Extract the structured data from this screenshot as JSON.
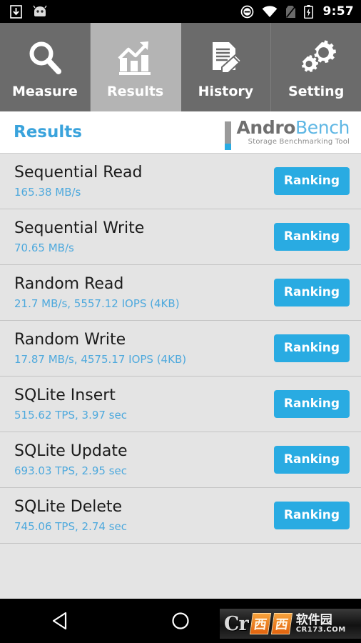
{
  "statusbar": {
    "time": "9:57",
    "left_icons": [
      "download-icon",
      "android-head-icon"
    ],
    "right_icons": [
      "do-not-disturb-icon",
      "wifi-icon",
      "no-sim-icon",
      "battery-charging-icon"
    ]
  },
  "tabs": [
    {
      "label": "Measure",
      "icon": "magnifier-icon",
      "active": false
    },
    {
      "label": "Results",
      "icon": "bar-chart-trend-icon",
      "active": true
    },
    {
      "label": "History",
      "icon": "document-pencil-icon",
      "active": false
    },
    {
      "label": "Setting",
      "icon": "gears-icon",
      "active": false
    }
  ],
  "header": {
    "title": "Results",
    "logo_primary": "Andro",
    "logo_secondary": "Bench",
    "logo_subtitle": "Storage Benchmarking Tool"
  },
  "results": {
    "button_label": "Ranking",
    "rows": [
      {
        "title": "Sequential Read",
        "value": "165.38 MB/s"
      },
      {
        "title": "Sequential Write",
        "value": "70.65 MB/s"
      },
      {
        "title": "Random Read",
        "value": "21.7 MB/s, 5557.12 IOPS (4KB)"
      },
      {
        "title": "Random Write",
        "value": "17.87 MB/s, 4575.17 IOPS (4KB)"
      },
      {
        "title": "SQLite Insert",
        "value": "515.62 TPS, 3.97 sec"
      },
      {
        "title": "SQLite Update",
        "value": "693.03 TPS, 2.95 sec"
      },
      {
        "title": "SQLite Delete",
        "value": "745.06 TPS, 2.74 sec"
      }
    ]
  },
  "navbar": {
    "back_icon": "triangle-back-icon",
    "home_icon": "circle-home-icon",
    "watermark": {
      "cr": "Cr",
      "box1": "西",
      "box2": "西",
      "cn": "软件园",
      "url": "CR173.COM"
    }
  },
  "colors": {
    "accent": "#29abe2",
    "tab_bg": "#6b6b6b",
    "tab_active_bg": "#b4b4b4",
    "list_bg": "#e4e4e4",
    "title_text": "#3aa3dc"
  }
}
